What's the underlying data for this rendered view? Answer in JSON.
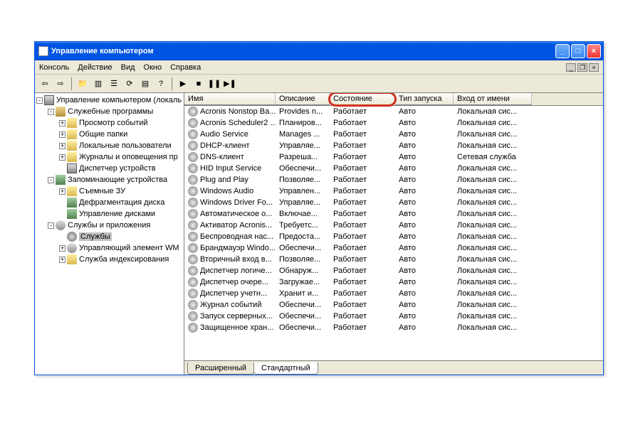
{
  "window": {
    "title": "Управление компьютером"
  },
  "menu": [
    "Консоль",
    "Действие",
    "Вид",
    "Окно",
    "Справка"
  ],
  "tree": [
    {
      "indent": 0,
      "exp": "-",
      "icon": "ic-comp",
      "label": "Управление компьютером (локаль"
    },
    {
      "indent": 1,
      "exp": "-",
      "icon": "ic-tool",
      "label": "Служебные программы"
    },
    {
      "indent": 2,
      "exp": "+",
      "icon": "ic-fold",
      "label": "Просмотр событий"
    },
    {
      "indent": 2,
      "exp": "+",
      "icon": "ic-fold",
      "label": "Общие папки"
    },
    {
      "indent": 2,
      "exp": "+",
      "icon": "ic-fold",
      "label": "Локальные пользователи"
    },
    {
      "indent": 2,
      "exp": "+",
      "icon": "ic-fold",
      "label": "Журналы и оповещения пр"
    },
    {
      "indent": 2,
      "exp": "",
      "icon": "ic-comp",
      "label": "Диспетчер устройств"
    },
    {
      "indent": 1,
      "exp": "-",
      "icon": "ic-disk",
      "label": "Запоминающие устройства"
    },
    {
      "indent": 2,
      "exp": "+",
      "icon": "ic-fold",
      "label": "Съемные ЗУ"
    },
    {
      "indent": 2,
      "exp": "",
      "icon": "ic-disk",
      "label": "Дефрагментация диска"
    },
    {
      "indent": 2,
      "exp": "",
      "icon": "ic-disk",
      "label": "Управление дисками"
    },
    {
      "indent": 1,
      "exp": "-",
      "icon": "ic-serv",
      "label": "Службы и приложения"
    },
    {
      "indent": 2,
      "exp": "",
      "icon": "ic-gear",
      "label": "Службы",
      "sel": true
    },
    {
      "indent": 2,
      "exp": "+",
      "icon": "ic-serv",
      "label": "Управляющий элемент WM"
    },
    {
      "indent": 2,
      "exp": "+",
      "icon": "ic-fold",
      "label": "Служба индексирования"
    }
  ],
  "columns": [
    {
      "label": "Имя",
      "w": "c-w0"
    },
    {
      "label": "Описание",
      "w": "c-w1"
    },
    {
      "label": "Состояние",
      "w": "c-w2",
      "highlight": true
    },
    {
      "label": "Тип запуска",
      "w": "c-w3"
    },
    {
      "label": "Вход от имени",
      "w": "c-w4"
    }
  ],
  "services": [
    [
      "Acronis Nonstop Ba...",
      "Provides n...",
      "Работает",
      "Авто",
      "Локальная сис..."
    ],
    [
      "Acronis Scheduler2 ...",
      "Планиров...",
      "Работает",
      "Авто",
      "Локальная сис..."
    ],
    [
      "Audio Service",
      "Manages ...",
      "Работает",
      "Авто",
      "Локальная сис..."
    ],
    [
      "DHCP-клиент",
      "Управляе...",
      "Работает",
      "Авто",
      "Локальная сис..."
    ],
    [
      "DNS-клиент",
      "Разреша...",
      "Работает",
      "Авто",
      "Сетевая служба"
    ],
    [
      "HID Input Service",
      "Обеспечи...",
      "Работает",
      "Авто",
      "Локальная сис..."
    ],
    [
      "Plug and Play",
      "Позволяе...",
      "Работает",
      "Авто",
      "Локальная сис..."
    ],
    [
      "Windows Audio",
      "Управлен...",
      "Работает",
      "Авто",
      "Локальная сис..."
    ],
    [
      "Windows Driver Fo...",
      "Управляе...",
      "Работает",
      "Авто",
      "Локальная сис..."
    ],
    [
      "Автоматическое о...",
      "Включае...",
      "Работает",
      "Авто",
      "Локальная сис..."
    ],
    [
      "Активатор Acronis...",
      "Требуетс...",
      "Работает",
      "Авто",
      "Локальная сис..."
    ],
    [
      "Беспроводная нас...",
      "Предоста...",
      "Работает",
      "Авто",
      "Локальная сис..."
    ],
    [
      "Брандмауэр Windo...",
      "Обеспечи...",
      "Работает",
      "Авто",
      "Локальная сис..."
    ],
    [
      "Вторичный вход в...",
      "Позволяе...",
      "Работает",
      "Авто",
      "Локальная сис..."
    ],
    [
      "Диспетчер логиче...",
      "Обнаруж...",
      "Работает",
      "Авто",
      "Локальная сис..."
    ],
    [
      "Диспетчер очере...",
      "Загружае...",
      "Работает",
      "Авто",
      "Локальная сис..."
    ],
    [
      "Диспетчер учетн...",
      "Хранит и...",
      "Работает",
      "Авто",
      "Локальная сис..."
    ],
    [
      "Журнал событий",
      "Обеспечи...",
      "Работает",
      "Авто",
      "Локальная сис..."
    ],
    [
      "Запуск серверных...",
      "Обеспечи...",
      "Работает",
      "Авто",
      "Локальная сис..."
    ],
    [
      "Защищенное хран...",
      "Обеспечи...",
      "Работает",
      "Авто",
      "Локальная сис..."
    ]
  ],
  "tabs": [
    {
      "label": "Расширенный",
      "active": false
    },
    {
      "label": "Стандартный",
      "active": true
    }
  ]
}
